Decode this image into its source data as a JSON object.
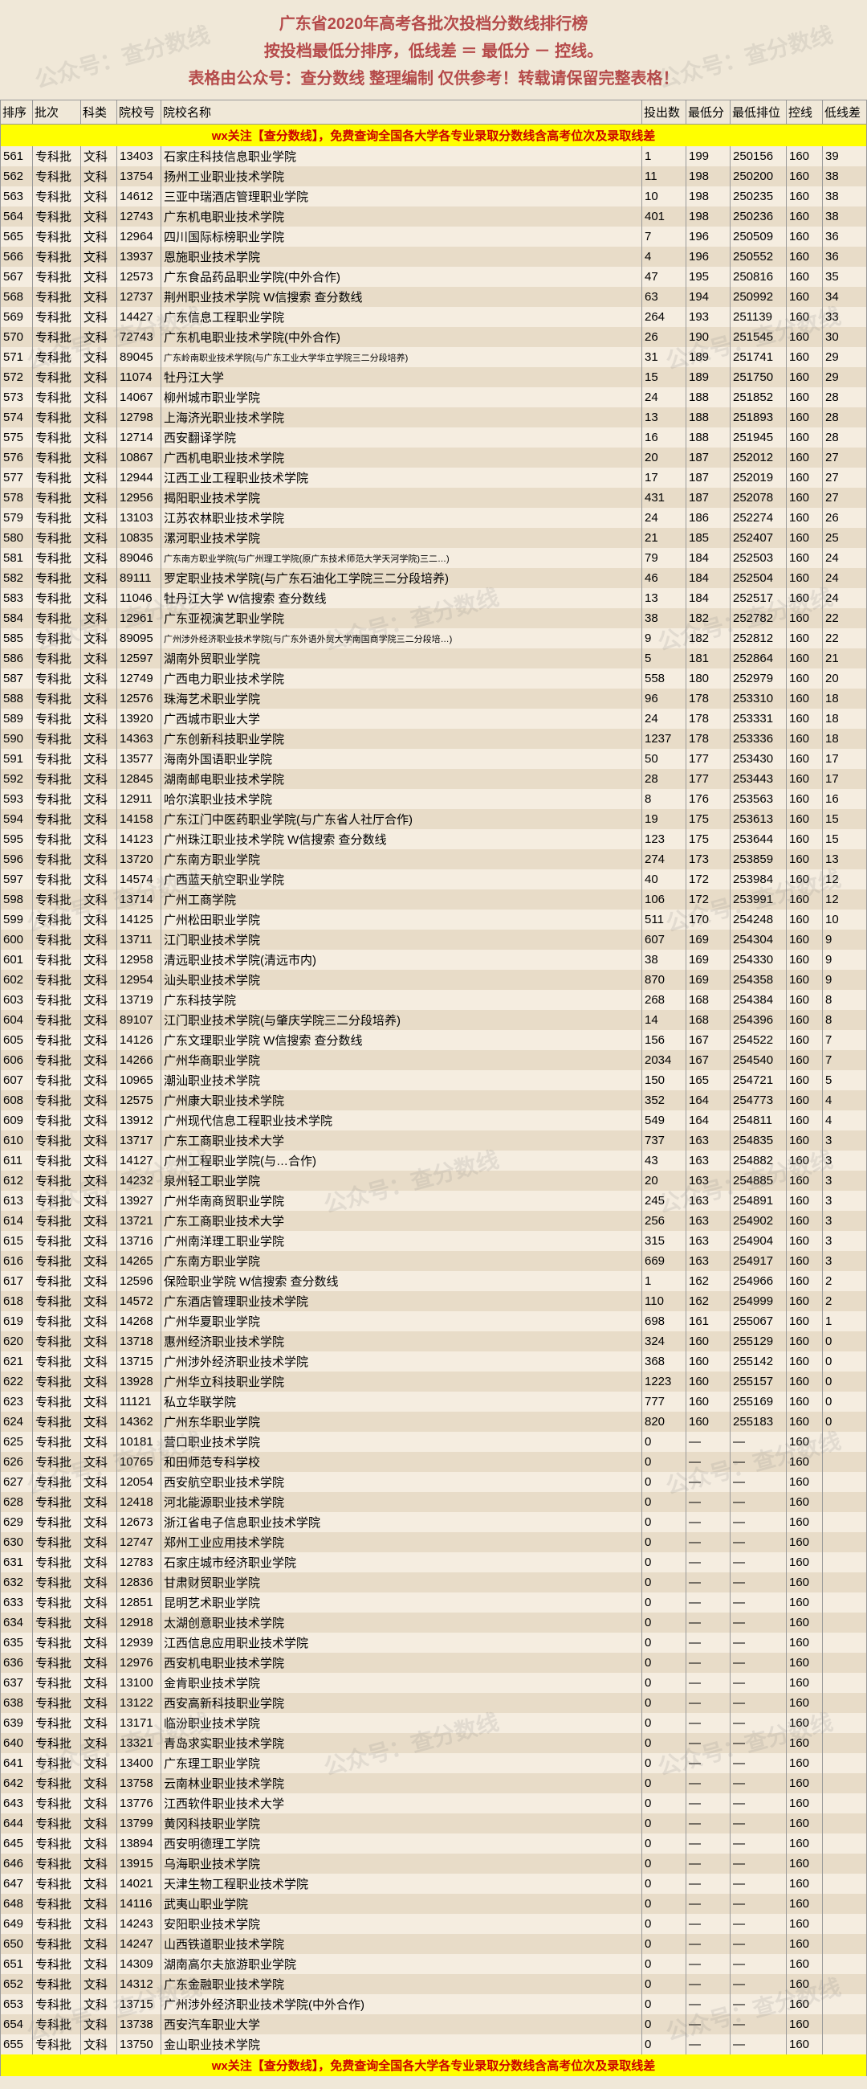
{
  "header": {
    "line1": "广东省2020年高考各批次投档分数线排行榜",
    "line2": "按投档最低分排序，低线差 ＝ 最低分 － 控线。",
    "line3": "表格由公众号：查分数线 整理编制 仅供参考！转载请保留完整表格！"
  },
  "columns": [
    "排序",
    "批次",
    "科类",
    "院校号",
    "院校名称",
    "投出数",
    "最低分",
    "最低排位",
    "控线",
    "低线差"
  ],
  "banner": "wx关注【查分数线】，免费查询全国各大学各专业录取分数线含高考位次及录取线差",
  "rows": [
    [
      "561",
      "专科批",
      "文科",
      "13403",
      "石家庄科技信息职业学院",
      "1",
      "199",
      "250156",
      "160",
      "39"
    ],
    [
      "562",
      "专科批",
      "文科",
      "13754",
      "扬州工业职业技术学院",
      "11",
      "198",
      "250200",
      "160",
      "38"
    ],
    [
      "563",
      "专科批",
      "文科",
      "14612",
      "三亚中瑞酒店管理职业学院",
      "10",
      "198",
      "250235",
      "160",
      "38"
    ],
    [
      "564",
      "专科批",
      "文科",
      "12743",
      "广东机电职业技术学院",
      "401",
      "198",
      "250236",
      "160",
      "38"
    ],
    [
      "565",
      "专科批",
      "文科",
      "12964",
      "四川国际标榜职业学院",
      "7",
      "196",
      "250509",
      "160",
      "36"
    ],
    [
      "566",
      "专科批",
      "文科",
      "13937",
      "恩施职业技术学院",
      "4",
      "196",
      "250552",
      "160",
      "36"
    ],
    [
      "567",
      "专科批",
      "文科",
      "12573",
      "广东食品药品职业学院(中外合作)",
      "47",
      "195",
      "250816",
      "160",
      "35"
    ],
    [
      "568",
      "专科批",
      "文科",
      "12737",
      "荆州职业技术学院 W信搜索 查分数线",
      "63",
      "194",
      "250992",
      "160",
      "34"
    ],
    [
      "569",
      "专科批",
      "文科",
      "14427",
      "广东信息工程职业学院",
      "264",
      "193",
      "251139",
      "160",
      "33"
    ],
    [
      "570",
      "专科批",
      "文科",
      "72743",
      "广东机电职业技术学院(中外合作)",
      "26",
      "190",
      "251545",
      "160",
      "30"
    ],
    [
      "571",
      "专科批",
      "文科",
      "89045",
      "广东岭南职业技术学院(与广东工业大学华立学院三二分段培养)",
      "31",
      "189",
      "251741",
      "160",
      "29"
    ],
    [
      "572",
      "专科批",
      "文科",
      "11074",
      "牡丹江大学",
      "15",
      "189",
      "251750",
      "160",
      "29"
    ],
    [
      "573",
      "专科批",
      "文科",
      "14067",
      "柳州城市职业学院",
      "24",
      "188",
      "251852",
      "160",
      "28"
    ],
    [
      "574",
      "专科批",
      "文科",
      "12798",
      "上海济光职业技术学院",
      "13",
      "188",
      "251893",
      "160",
      "28"
    ],
    [
      "575",
      "专科批",
      "文科",
      "12714",
      "西安翻译学院",
      "16",
      "188",
      "251945",
      "160",
      "28"
    ],
    [
      "576",
      "专科批",
      "文科",
      "10867",
      "广西机电职业技术学院",
      "20",
      "187",
      "252012",
      "160",
      "27"
    ],
    [
      "577",
      "专科批",
      "文科",
      "12944",
      "江西工业工程职业技术学院",
      "17",
      "187",
      "252019",
      "160",
      "27"
    ],
    [
      "578",
      "专科批",
      "文科",
      "12956",
      "揭阳职业技术学院",
      "431",
      "187",
      "252078",
      "160",
      "27"
    ],
    [
      "579",
      "专科批",
      "文科",
      "13103",
      "江苏农林职业技术学院",
      "24",
      "186",
      "252274",
      "160",
      "26"
    ],
    [
      "580",
      "专科批",
      "文科",
      "10835",
      "漯河职业技术学院",
      "21",
      "185",
      "252407",
      "160",
      "25"
    ],
    [
      "581",
      "专科批",
      "文科",
      "89046",
      "广东南方职业学院(与广州理工学院(原广东技术师范大学天河学院)三二…)",
      "79",
      "184",
      "252503",
      "160",
      "24"
    ],
    [
      "582",
      "专科批",
      "文科",
      "89111",
      "罗定职业技术学院(与广东石油化工学院三二分段培养)",
      "46",
      "184",
      "252504",
      "160",
      "24"
    ],
    [
      "583",
      "专科批",
      "文科",
      "11046",
      "牡丹江大学 W信搜索 查分数线",
      "13",
      "184",
      "252517",
      "160",
      "24"
    ],
    [
      "584",
      "专科批",
      "文科",
      "12961",
      "广东亚视演艺职业学院",
      "38",
      "182",
      "252782",
      "160",
      "22"
    ],
    [
      "585",
      "专科批",
      "文科",
      "89095",
      "广州涉外经济职业技术学院(与广东外语外贸大学南国商学院三二分段培…)",
      "9",
      "182",
      "252812",
      "160",
      "22"
    ],
    [
      "586",
      "专科批",
      "文科",
      "12597",
      "湖南外贸职业学院",
      "5",
      "181",
      "252864",
      "160",
      "21"
    ],
    [
      "587",
      "专科批",
      "文科",
      "12749",
      "广西电力职业技术学院",
      "558",
      "180",
      "252979",
      "160",
      "20"
    ],
    [
      "588",
      "专科批",
      "文科",
      "12576",
      "珠海艺术职业学院",
      "96",
      "178",
      "253310",
      "160",
      "18"
    ],
    [
      "589",
      "专科批",
      "文科",
      "13920",
      "广西城市职业大学",
      "24",
      "178",
      "253331",
      "160",
      "18"
    ],
    [
      "590",
      "专科批",
      "文科",
      "14363",
      "广东创新科技职业学院",
      "1237",
      "178",
      "253336",
      "160",
      "18"
    ],
    [
      "591",
      "专科批",
      "文科",
      "13577",
      "海南外国语职业学院",
      "50",
      "177",
      "253430",
      "160",
      "17"
    ],
    [
      "592",
      "专科批",
      "文科",
      "12845",
      "湖南邮电职业技术学院",
      "28",
      "177",
      "253443",
      "160",
      "17"
    ],
    [
      "593",
      "专科批",
      "文科",
      "12911",
      "哈尔滨职业技术学院",
      "8",
      "176",
      "253563",
      "160",
      "16"
    ],
    [
      "594",
      "专科批",
      "文科",
      "14158",
      "广东江门中医药职业学院(与广东省人社厅合作)",
      "19",
      "175",
      "253613",
      "160",
      "15"
    ],
    [
      "595",
      "专科批",
      "文科",
      "14123",
      "广州珠江职业技术学院 W信搜索 查分数线",
      "123",
      "175",
      "253644",
      "160",
      "15"
    ],
    [
      "596",
      "专科批",
      "文科",
      "13720",
      "广东南方职业学院",
      "274",
      "173",
      "253859",
      "160",
      "13"
    ],
    [
      "597",
      "专科批",
      "文科",
      "14574",
      "广西蓝天航空职业学院",
      "40",
      "172",
      "253984",
      "160",
      "12"
    ],
    [
      "598",
      "专科批",
      "文科",
      "13714",
      "广州工商学院",
      "106",
      "172",
      "253991",
      "160",
      "12"
    ],
    [
      "599",
      "专科批",
      "文科",
      "14125",
      "广州松田职业学院",
      "511",
      "170",
      "254248",
      "160",
      "10"
    ],
    [
      "600",
      "专科批",
      "文科",
      "13711",
      "江门职业技术学院",
      "607",
      "169",
      "254304",
      "160",
      "9"
    ],
    [
      "601",
      "专科批",
      "文科",
      "12958",
      "清远职业技术学院(清远市内)",
      "38",
      "169",
      "254330",
      "160",
      "9"
    ],
    [
      "602",
      "专科批",
      "文科",
      "12954",
      "汕头职业技术学院",
      "870",
      "169",
      "254358",
      "160",
      "9"
    ],
    [
      "603",
      "专科批",
      "文科",
      "13719",
      "广东科技学院",
      "268",
      "168",
      "254384",
      "160",
      "8"
    ],
    [
      "604",
      "专科批",
      "文科",
      "89107",
      "江门职业技术学院(与肇庆学院三二分段培养)",
      "14",
      "168",
      "254396",
      "160",
      "8"
    ],
    [
      "605",
      "专科批",
      "文科",
      "14126",
      "广东文理职业学院 W信搜索 查分数线",
      "156",
      "167",
      "254522",
      "160",
      "7"
    ],
    [
      "606",
      "专科批",
      "文科",
      "14266",
      "广州华商职业学院",
      "2034",
      "167",
      "254540",
      "160",
      "7"
    ],
    [
      "607",
      "专科批",
      "文科",
      "10965",
      "潮汕职业技术学院",
      "150",
      "165",
      "254721",
      "160",
      "5"
    ],
    [
      "608",
      "专科批",
      "文科",
      "12575",
      "广州康大职业技术学院",
      "352",
      "164",
      "254773",
      "160",
      "4"
    ],
    [
      "609",
      "专科批",
      "文科",
      "13912",
      "广州现代信息工程职业技术学院",
      "549",
      "164",
      "254811",
      "160",
      "4"
    ],
    [
      "610",
      "专科批",
      "文科",
      "13717",
      "广东工商职业技术大学",
      "737",
      "163",
      "254835",
      "160",
      "3"
    ],
    [
      "611",
      "专科批",
      "文科",
      "14127",
      "广州工程职业学院(与…合作)",
      "43",
      "163",
      "254882",
      "160",
      "3"
    ],
    [
      "612",
      "专科批",
      "文科",
      "14232",
      "泉州轻工职业学院",
      "20",
      "163",
      "254885",
      "160",
      "3"
    ],
    [
      "613",
      "专科批",
      "文科",
      "13927",
      "广州华南商贸职业学院",
      "245",
      "163",
      "254891",
      "160",
      "3"
    ],
    [
      "614",
      "专科批",
      "文科",
      "13721",
      "广东工商职业技术大学",
      "256",
      "163",
      "254902",
      "160",
      "3"
    ],
    [
      "615",
      "专科批",
      "文科",
      "13716",
      "广州南洋理工职业学院",
      "315",
      "163",
      "254904",
      "160",
      "3"
    ],
    [
      "616",
      "专科批",
      "文科",
      "14265",
      "广东南方职业学院",
      "669",
      "163",
      "254917",
      "160",
      "3"
    ],
    [
      "617",
      "专科批",
      "文科",
      "12596",
      "保险职业学院 W信搜索 查分数线",
      "1",
      "162",
      "254966",
      "160",
      "2"
    ],
    [
      "618",
      "专科批",
      "文科",
      "14572",
      "广东酒店管理职业技术学院",
      "110",
      "162",
      "254999",
      "160",
      "2"
    ],
    [
      "619",
      "专科批",
      "文科",
      "14268",
      "广州华夏职业学院",
      "698",
      "161",
      "255067",
      "160",
      "1"
    ],
    [
      "620",
      "专科批",
      "文科",
      "13718",
      "惠州经济职业技术学院",
      "324",
      "160",
      "255129",
      "160",
      "0"
    ],
    [
      "621",
      "专科批",
      "文科",
      "13715",
      "广州涉外经济职业技术学院",
      "368",
      "160",
      "255142",
      "160",
      "0"
    ],
    [
      "622",
      "专科批",
      "文科",
      "13928",
      "广州华立科技职业学院",
      "1223",
      "160",
      "255157",
      "160",
      "0"
    ],
    [
      "623",
      "专科批",
      "文科",
      "11121",
      "私立华联学院",
      "777",
      "160",
      "255169",
      "160",
      "0"
    ],
    [
      "624",
      "专科批",
      "文科",
      "14362",
      "广州东华职业学院",
      "820",
      "160",
      "255183",
      "160",
      "0"
    ],
    [
      "625",
      "专科批",
      "文科",
      "10181",
      "营口职业技术学院",
      "0",
      "—",
      "—",
      "160",
      ""
    ],
    [
      "626",
      "专科批",
      "文科",
      "10765",
      "和田师范专科学校",
      "0",
      "—",
      "—",
      "160",
      ""
    ],
    [
      "627",
      "专科批",
      "文科",
      "12054",
      "西安航空职业技术学院",
      "0",
      "—",
      "—",
      "160",
      ""
    ],
    [
      "628",
      "专科批",
      "文科",
      "12418",
      "河北能源职业技术学院",
      "0",
      "—",
      "—",
      "160",
      ""
    ],
    [
      "629",
      "专科批",
      "文科",
      "12673",
      "浙江省电子信息职业技术学院",
      "0",
      "—",
      "—",
      "160",
      ""
    ],
    [
      "630",
      "专科批",
      "文科",
      "12747",
      "郑州工业应用技术学院",
      "0",
      "—",
      "—",
      "160",
      ""
    ],
    [
      "631",
      "专科批",
      "文科",
      "12783",
      "石家庄城市经济职业学院",
      "0",
      "—",
      "—",
      "160",
      ""
    ],
    [
      "632",
      "专科批",
      "文科",
      "12836",
      "甘肃财贸职业学院",
      "0",
      "—",
      "—",
      "160",
      ""
    ],
    [
      "633",
      "专科批",
      "文科",
      "12851",
      "昆明艺术职业学院",
      "0",
      "—",
      "—",
      "160",
      ""
    ],
    [
      "634",
      "专科批",
      "文科",
      "12918",
      "太湖创意职业技术学院",
      "0",
      "—",
      "—",
      "160",
      ""
    ],
    [
      "635",
      "专科批",
      "文科",
      "12939",
      "江西信息应用职业技术学院",
      "0",
      "—",
      "—",
      "160",
      ""
    ],
    [
      "636",
      "专科批",
      "文科",
      "12976",
      "西安机电职业技术学院",
      "0",
      "—",
      "—",
      "160",
      ""
    ],
    [
      "637",
      "专科批",
      "文科",
      "13100",
      "金肯职业技术学院",
      "0",
      "—",
      "—",
      "160",
      ""
    ],
    [
      "638",
      "专科批",
      "文科",
      "13122",
      "西安高新科技职业学院",
      "0",
      "—",
      "—",
      "160",
      ""
    ],
    [
      "639",
      "专科批",
      "文科",
      "13171",
      "临汾职业技术学院",
      "0",
      "—",
      "—",
      "160",
      ""
    ],
    [
      "640",
      "专科批",
      "文科",
      "13321",
      "青岛求实职业技术学院",
      "0",
      "—",
      "—",
      "160",
      ""
    ],
    [
      "641",
      "专科批",
      "文科",
      "13400",
      "广东理工职业学院",
      "0",
      "—",
      "—",
      "160",
      ""
    ],
    [
      "642",
      "专科批",
      "文科",
      "13758",
      "云南林业职业技术学院",
      "0",
      "—",
      "—",
      "160",
      ""
    ],
    [
      "643",
      "专科批",
      "文科",
      "13776",
      "江西软件职业技术大学",
      "0",
      "—",
      "—",
      "160",
      ""
    ],
    [
      "644",
      "专科批",
      "文科",
      "13799",
      "黄冈科技职业学院",
      "0",
      "—",
      "—",
      "160",
      ""
    ],
    [
      "645",
      "专科批",
      "文科",
      "13894",
      "西安明德理工学院",
      "0",
      "—",
      "—",
      "160",
      ""
    ],
    [
      "646",
      "专科批",
      "文科",
      "13915",
      "乌海职业技术学院",
      "0",
      "—",
      "—",
      "160",
      ""
    ],
    [
      "647",
      "专科批",
      "文科",
      "14021",
      "天津生物工程职业技术学院",
      "0",
      "—",
      "—",
      "160",
      ""
    ],
    [
      "648",
      "专科批",
      "文科",
      "14116",
      "武夷山职业学院",
      "0",
      "—",
      "—",
      "160",
      ""
    ],
    [
      "649",
      "专科批",
      "文科",
      "14243",
      "安阳职业技术学院",
      "0",
      "—",
      "—",
      "160",
      ""
    ],
    [
      "650",
      "专科批",
      "文科",
      "14247",
      "山西铁道职业技术学院",
      "0",
      "—",
      "—",
      "160",
      ""
    ],
    [
      "651",
      "专科批",
      "文科",
      "14309",
      "湖南高尔夫旅游职业学院",
      "0",
      "—",
      "—",
      "160",
      ""
    ],
    [
      "652",
      "专科批",
      "文科",
      "14312",
      "广东金融职业技术学院",
      "0",
      "—",
      "—",
      "160",
      ""
    ],
    [
      "653",
      "专科批",
      "文科",
      "13715",
      "广州涉外经济职业技术学院(中外合作)",
      "0",
      "—",
      "—",
      "160",
      ""
    ],
    [
      "654",
      "专科批",
      "文科",
      "13738",
      "西安汽车职业大学",
      "0",
      "—",
      "—",
      "160",
      ""
    ],
    [
      "655",
      "专科批",
      "文科",
      "13750",
      "金山职业技术学院",
      "0",
      "—",
      "—",
      "160",
      ""
    ]
  ],
  "watermark": "公众号：查分数线"
}
